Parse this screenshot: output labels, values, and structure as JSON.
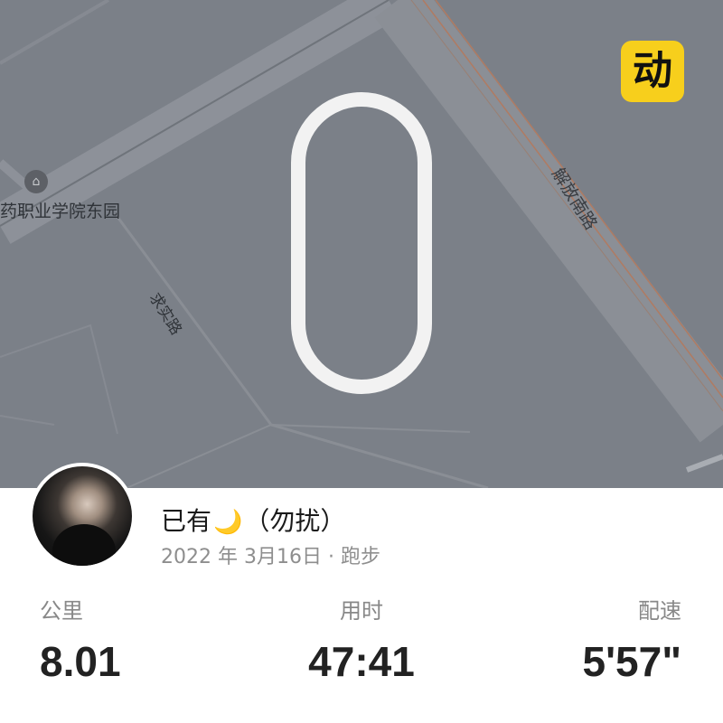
{
  "map": {
    "labels": {
      "campus": "药职业学院东园",
      "qiushi_road": "求实路",
      "jiefang_road": "解放南路"
    },
    "icons": {
      "school": "school-icon",
      "app_logo": "app-logo-icon"
    },
    "app_logo_char": "动",
    "colors": {
      "background": "#7b8088",
      "route": "#f2f2f2",
      "logo": "#f7cf1c"
    }
  },
  "user": {
    "name": "已有",
    "name_suffix": "（勿扰）",
    "moon": "🌙",
    "date": "2022 年 3月16日",
    "separator": "·",
    "activity": "跑步"
  },
  "stats": {
    "distance": {
      "label": "公里",
      "value": "8.01"
    },
    "time": {
      "label": "用时",
      "value": "47:41"
    },
    "pace": {
      "label": "配速",
      "value": "5'57\""
    }
  }
}
